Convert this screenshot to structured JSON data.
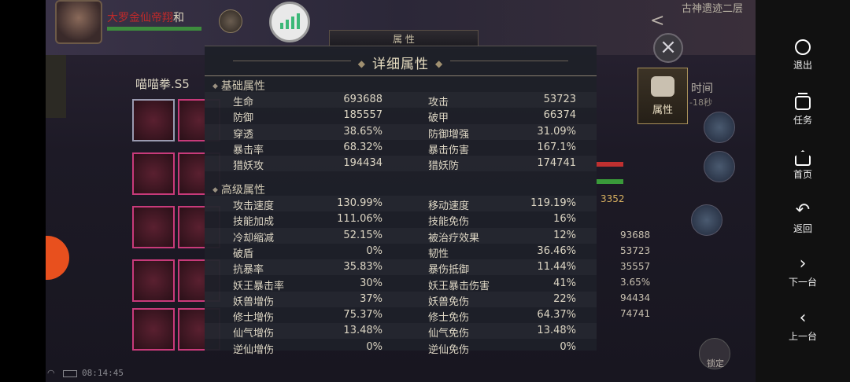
{
  "game": {
    "player_name": "大罗金仙帝翔",
    "player_name_suffix": "和",
    "map_name": "古神遗迹二层",
    "top_tab_label": "属 性",
    "left_panel_title": "喵喵拳.S5",
    "attr_tab_label": "属性",
    "time_label": "时间",
    "time_sub": "-18秒",
    "gold_value": "3352",
    "bg_numbers": [
      "93688",
      "53723",
      "35557",
      "3.65%",
      "94434",
      "74741"
    ],
    "lock_label": "锁定",
    "status_time": "08:14:45"
  },
  "popup": {
    "title": "详细属性",
    "basic": {
      "title": "基础属性",
      "rows": [
        {
          "l": "生命",
          "lv": "693688",
          "r": "攻击",
          "rv": "53723"
        },
        {
          "l": "防御",
          "lv": "185557",
          "r": "破甲",
          "rv": "66374"
        },
        {
          "l": "穿透",
          "lv": "38.65%",
          "r": "防御增强",
          "rv": "31.09%"
        },
        {
          "l": "暴击率",
          "lv": "68.32%",
          "r": "暴击伤害",
          "rv": "167.1%"
        },
        {
          "l": "猎妖攻",
          "lv": "194434",
          "r": "猎妖防",
          "rv": "174741"
        }
      ]
    },
    "advanced": {
      "title": "高级属性",
      "rows": [
        {
          "l": "攻击速度",
          "lv": "130.99%",
          "r": "移动速度",
          "rv": "119.19%"
        },
        {
          "l": "技能加成",
          "lv": "111.06%",
          "r": "技能免伤",
          "rv": "16%"
        },
        {
          "l": "冷却缩减",
          "lv": "52.15%",
          "r": "被治疗效果",
          "rv": "12%"
        },
        {
          "l": "破盾",
          "lv": "0%",
          "r": "韧性",
          "rv": "36.46%"
        },
        {
          "l": "抗暴率",
          "lv": "35.83%",
          "r": "暴伤抵御",
          "rv": "11.44%"
        },
        {
          "l": "妖王暴击率",
          "lv": "30%",
          "r": "妖王暴击伤害",
          "rv": "41%"
        },
        {
          "l": "妖兽增伤",
          "lv": "37%",
          "r": "妖兽免伤",
          "rv": "22%"
        },
        {
          "l": "修士增伤",
          "lv": "75.37%",
          "r": "修士免伤",
          "rv": "64.37%"
        },
        {
          "l": "仙气增伤",
          "lv": "13.48%",
          "r": "仙气免伤",
          "rv": "13.48%"
        },
        {
          "l": "逆仙增伤",
          "lv": "0%",
          "r": "逆仙免伤",
          "rv": "0%"
        }
      ]
    }
  },
  "navbar": {
    "items": [
      {
        "label": "退出",
        "icon": "exit-icon"
      },
      {
        "label": "任务",
        "icon": "task-icon"
      },
      {
        "label": "首页",
        "icon": "home-icon"
      },
      {
        "label": "返回",
        "icon": "back-icon"
      },
      {
        "label": "下一台",
        "icon": "chevron-right-icon"
      },
      {
        "label": "上一台",
        "icon": "chevron-left-icon"
      }
    ]
  },
  "colors": {
    "rarity_border": "#c83a7a",
    "signal_green": "#3cb878",
    "popup_bg": "#1e2028",
    "nav_bg": "#111111"
  }
}
